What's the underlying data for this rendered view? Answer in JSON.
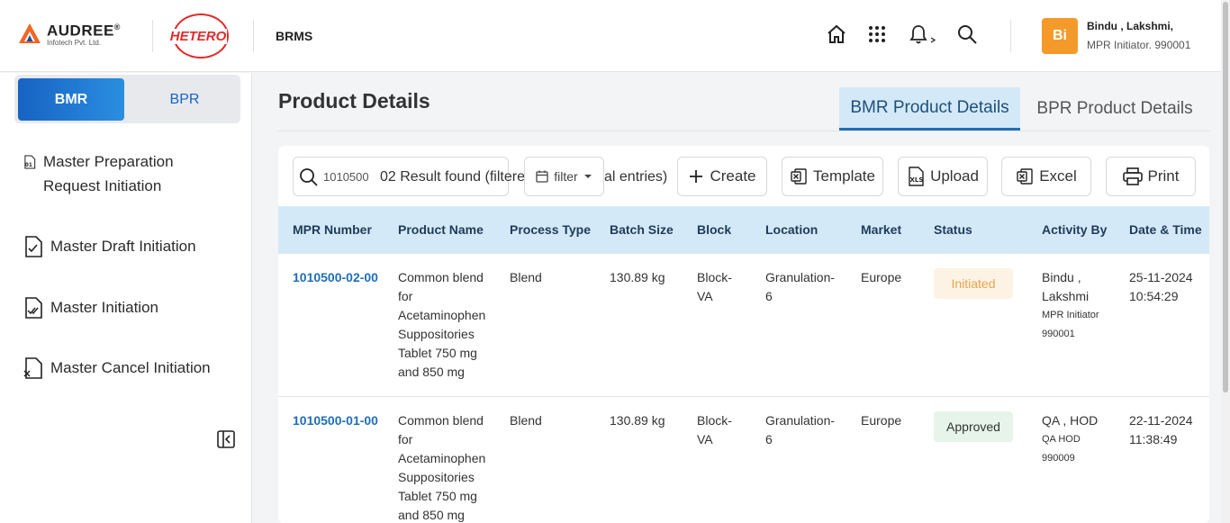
{
  "header": {
    "company_brand": "AUDREE",
    "company_sub": "Infotech Pvt. Ltd.",
    "client_brand": "HETERO",
    "app_name": "BRMS",
    "icons": [
      "home-icon",
      "apps-grid-icon",
      "bell-icon",
      "search-icon"
    ],
    "user": {
      "initials": "Bi",
      "name": "Bindu , Lakshmi,",
      "role": "MPR Initiator. 990001"
    }
  },
  "sidebar": {
    "toggle": {
      "bmr": "BMR",
      "bpr": "BPR"
    },
    "items": [
      {
        "label": "Master Preparation Request Initiation",
        "icon": "document-01-icon"
      },
      {
        "label": "Master Draft Initiation",
        "icon": "document-check-icon"
      },
      {
        "label": "Master Initiation",
        "icon": "document-double-check-icon"
      },
      {
        "label": "Master Cancel Initiation",
        "icon": "document-cancel-icon"
      }
    ]
  },
  "main": {
    "title": "Product Details",
    "tabs": [
      {
        "label": "BMR Product Details",
        "active": true
      },
      {
        "label": "BPR Product Details",
        "active": false
      }
    ],
    "toolbar": {
      "search_value": "1010500",
      "result_text": "02 Result found (filtered",
      "result_tail": "al entries)",
      "filter_label": "filter",
      "buttons": {
        "create": "Create",
        "template": "Template",
        "upload": "Upload",
        "excel": "Excel",
        "print": "Print"
      }
    },
    "table": {
      "columns": [
        "MPR Number",
        "Product Name",
        "Process Type",
        "Batch Size",
        "Block",
        "Location",
        "Market",
        "Status",
        "Activity By",
        "Date & Time"
      ],
      "rows": [
        {
          "mpr": "1010500-02-00",
          "product": [
            "Common blend",
            "for",
            "Acetaminophen",
            "Suppositories",
            "Tablet 750 mg",
            "and 850 mg"
          ],
          "process": "Blend",
          "batch": "130.89 kg",
          "block": [
            "Block-",
            "VA"
          ],
          "location": [
            "Granulation-",
            "6"
          ],
          "market": "Europe",
          "status": "Initiated",
          "activity": [
            "Bindu ,",
            "Lakshmi"
          ],
          "activity_role": [
            "MPR Initiator",
            "990001"
          ],
          "date": "25-11-2024",
          "time": "10:54:29"
        },
        {
          "mpr": "1010500-01-00",
          "product": [
            "Common blend",
            "for",
            "Acetaminophen",
            "Suppositories",
            "Tablet 750 mg",
            "and 850 mg"
          ],
          "process": "Blend",
          "batch": "130.89 kg",
          "block": [
            "Block-",
            "VA"
          ],
          "location": [
            "Granulation-",
            "6"
          ],
          "market": "Europe",
          "status": "Approved",
          "activity": [
            "QA , HOD"
          ],
          "activity_role": [
            "QA HOD",
            "990009"
          ],
          "date": "22-11-2024",
          "time": "11:38:49"
        }
      ]
    }
  },
  "colors": {
    "primary": "#1763c2",
    "accent_orange": "#f39a2b",
    "header_row": "#d4e9f8",
    "hetero_red": "#e02a2a"
  }
}
